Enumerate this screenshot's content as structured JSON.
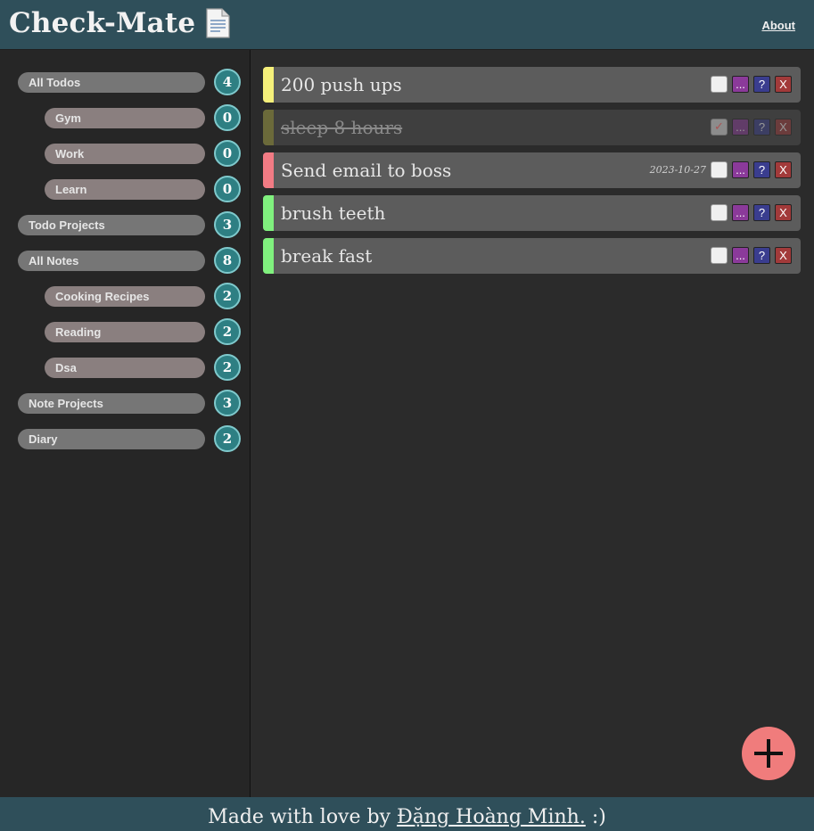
{
  "header": {
    "title": "Check-Mate",
    "title_icon": "document-icon",
    "about": "About"
  },
  "sidebar": {
    "items": [
      {
        "label": "All Todos",
        "count": "4",
        "level": "top"
      },
      {
        "label": "Gym",
        "count": "0",
        "level": "sub"
      },
      {
        "label": "Work",
        "count": "0",
        "level": "sub"
      },
      {
        "label": "Learn",
        "count": "0",
        "level": "sub"
      },
      {
        "label": "Todo Projects",
        "count": "3",
        "level": "top"
      },
      {
        "label": "All Notes",
        "count": "8",
        "level": "top"
      },
      {
        "label": "Cooking Recipes",
        "count": "2",
        "level": "sub"
      },
      {
        "label": "Reading",
        "count": "2",
        "level": "sub"
      },
      {
        "label": "Dsa",
        "count": "2",
        "level": "sub"
      },
      {
        "label": "Note Projects",
        "count": "3",
        "level": "top"
      },
      {
        "label": "Diary",
        "count": "2",
        "level": "top"
      }
    ]
  },
  "todos": [
    {
      "title": "200 push ups",
      "priority_color": "#f5f07a",
      "done": false,
      "date": ""
    },
    {
      "title": "sleep 8 hours",
      "priority_color": "#6b6a3a",
      "done": true,
      "date": ""
    },
    {
      "title": "Send email to boss",
      "priority_color": "#f27b84",
      "done": false,
      "date": "2023-10-27"
    },
    {
      "title": "brush teeth",
      "priority_color": "#80f07e",
      "done": false,
      "date": ""
    },
    {
      "title": "break fast",
      "priority_color": "#80f07e",
      "done": false,
      "date": ""
    }
  ],
  "controls": {
    "more": "...",
    "info": "?",
    "delete": "X",
    "check_mark": "✓"
  },
  "footer": {
    "prefix": "Made with love by ",
    "author": "Đặng Hoàng Minh.",
    "suffix": " :)"
  },
  "colors": {
    "header_bg": "#2f4f5a",
    "fab": "#f07c7c",
    "badge": "#2e7f83"
  }
}
